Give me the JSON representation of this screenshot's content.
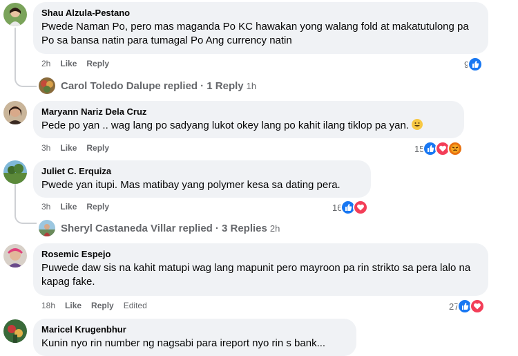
{
  "comments": [
    {
      "author": "Shau Alzula-Pestano",
      "text": "Pwede Naman Po, pero mas maganda Po KC hawakan yong walang fold at makatutulong pa Po sa bansa natin para tumagal Po Ang currency natin",
      "time": "2h",
      "like_label": "Like",
      "reply_label": "Reply",
      "reaction_count": "9",
      "reactions": [
        "like-icon"
      ],
      "replied_by": "Carol Toledo Dalupe replied",
      "replies_label": "· 1 Reply",
      "replies_time": "1h"
    },
    {
      "author": "Maryann Nariz Dela Cruz",
      "text": "Pede po yan .. wag lang po sadyang lukot okey lang po kahit ilang tiklop pa yan.",
      "time": "3h",
      "like_label": "Like",
      "reply_label": "Reply",
      "reaction_count": "15",
      "reactions": [
        "like-icon",
        "love-icon",
        "angry-icon"
      ]
    },
    {
      "author": "Juliet C. Erquiza",
      "text": "Pwede yan itupi. Mas matibay yang polymer kesa sa dating pera.",
      "time": "3h",
      "like_label": "Like",
      "reply_label": "Reply",
      "reaction_count": "16",
      "reactions": [
        "like-icon",
        "love-icon"
      ],
      "replied_by": "Sheryl Castaneda Villar replied",
      "replies_label": "· 3 Replies",
      "replies_time": "2h"
    },
    {
      "author": "Rosemic Espejo",
      "text": "Puwede daw sis na kahit matupi wag lang mapunit pero mayroon pa rin strikto sa pera lalo na kapag fake.",
      "time": "18h",
      "like_label": "Like",
      "reply_label": "Reply",
      "edited_label": "Edited",
      "reaction_count": "27",
      "reactions": [
        "like-icon",
        "love-icon"
      ]
    },
    {
      "author": "Maricel Krugenbhur",
      "text": "Kunin nyo rin number ng nagsabi para ireport nyo rin s bank..."
    }
  ],
  "colors": {
    "bubble": "#f0f2f5",
    "like": "#1877f2",
    "love": "#f33e58",
    "angry": "#e9710f",
    "meta": "#65676b"
  }
}
